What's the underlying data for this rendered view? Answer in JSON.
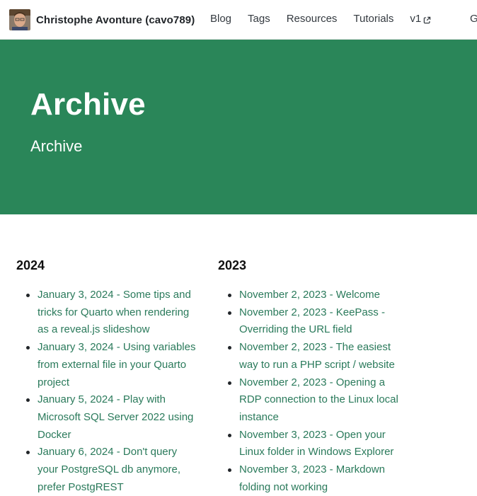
{
  "navbar": {
    "brand_title": "Christophe Avonture (cavo789)",
    "links": [
      {
        "label": "Blog"
      },
      {
        "label": "Tags"
      },
      {
        "label": "Resources"
      },
      {
        "label": "Tutorials"
      },
      {
        "label": "v1",
        "icon": "external-link-icon"
      }
    ],
    "cut_off_label": "G"
  },
  "hero": {
    "title": "Archive",
    "subtitle": "Archive",
    "background_color": "#2a8659"
  },
  "archive": {
    "link_color": "#2a7a5b",
    "columns": [
      {
        "year": "2024",
        "posts": [
          "January 3, 2024 - Some tips and tricks for Quarto when rendering as a reveal.js slideshow",
          "January 3, 2024 - Using variables from external file in your Quarto project",
          "January 5, 2024 - Play with Microsoft SQL Server 2022 using Docker",
          "January 6, 2024 - Don't query your PostgreSQL db anymore, prefer PostgREST"
        ]
      },
      {
        "year": "2023",
        "posts": [
          "November 2, 2023 - Welcome",
          "November 2, 2023 - KeePass - Overriding the URL field",
          "November 2, 2023 - The easiest way to run a PHP script / website",
          "November 2, 2023 - Opening a RDP connection to the Linux local instance",
          "November 3, 2023 - Open your Linux folder in Windows Explorer",
          "November 3, 2023 - Markdown folding not working"
        ]
      }
    ]
  }
}
